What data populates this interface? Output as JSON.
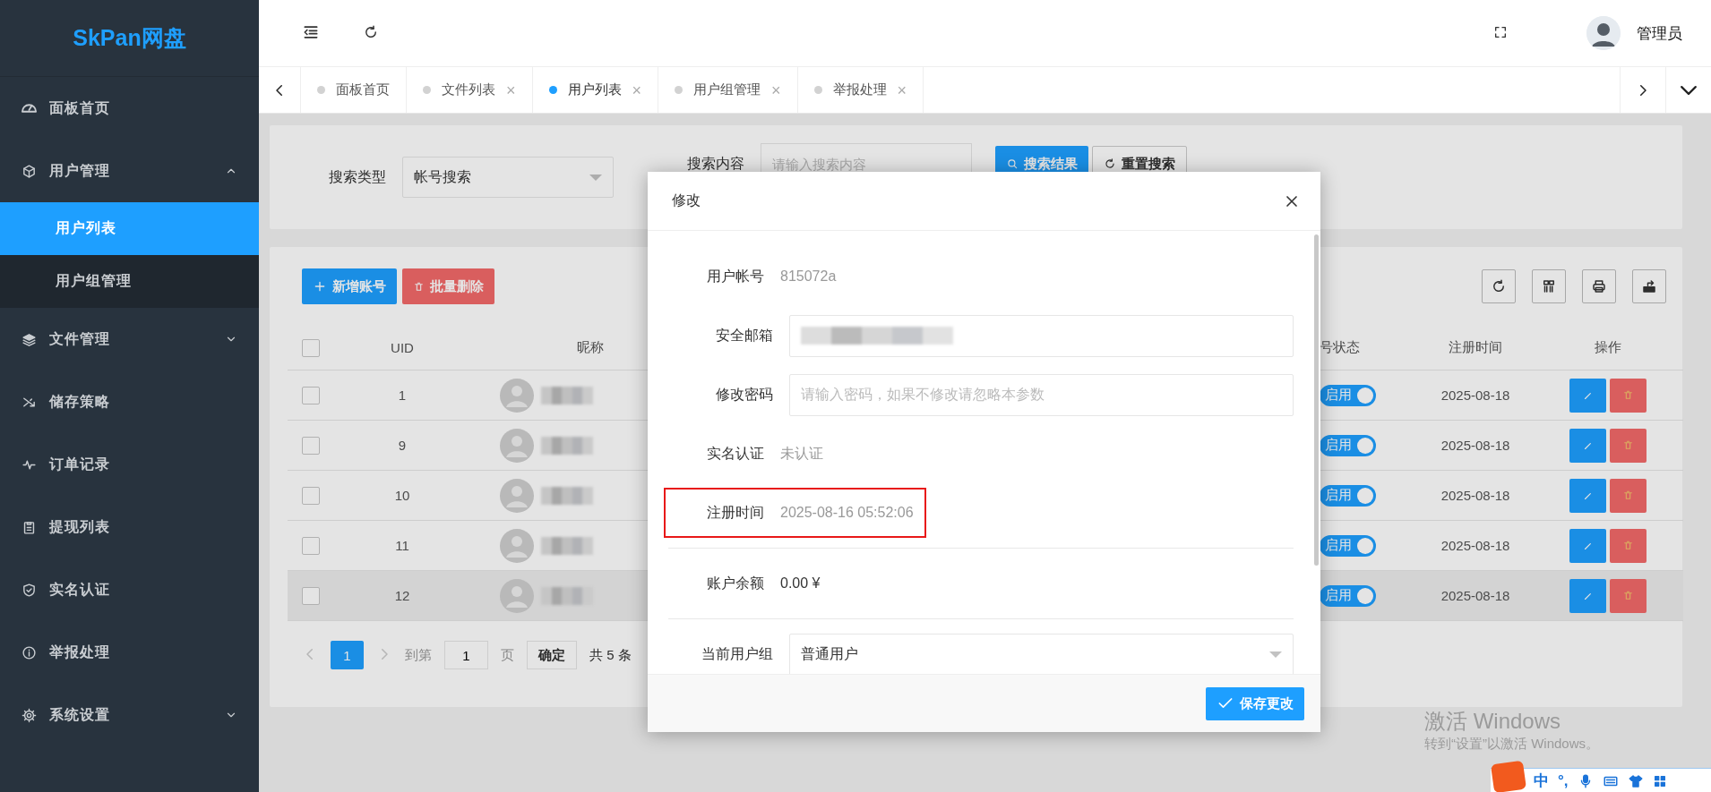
{
  "sidebar": {
    "logo": "SkPan网盘",
    "items": [
      {
        "label": "面板首页",
        "selected": false
      },
      {
        "label": "用户管理",
        "selected": false,
        "expanded": true,
        "children": [
          {
            "label": "用户列表",
            "selected": true
          },
          {
            "label": "用户组管理",
            "selected": false
          }
        ]
      },
      {
        "label": "文件管理",
        "selected": false,
        "expanded": false
      },
      {
        "label": "储存策略",
        "selected": false
      },
      {
        "label": "订单记录",
        "selected": false
      },
      {
        "label": "提现列表",
        "selected": false
      },
      {
        "label": "实名认证",
        "selected": false
      },
      {
        "label": "举报处理",
        "selected": false
      },
      {
        "label": "系统设置",
        "selected": false,
        "expanded": false
      }
    ]
  },
  "header": {
    "user": "管理员"
  },
  "tabs": [
    {
      "label": "面板首页",
      "selected": false
    },
    {
      "label": "文件列表",
      "close": "×",
      "selected": false
    },
    {
      "label": "用户列表",
      "close": "×",
      "selected": true
    },
    {
      "label": "用户组管理",
      "close": "×",
      "selected": false
    },
    {
      "label": "举报处理",
      "close": "×",
      "selected": false
    }
  ],
  "search": {
    "type_label": "搜索类型",
    "type_value": "帐号搜索",
    "content_label": "搜索内容",
    "content_placeholder": "请输入搜索内容",
    "buttons": [
      "搜索结果",
      "重置搜索"
    ]
  },
  "table": {
    "actions": [
      "新增账号",
      "批量删除"
    ],
    "columns": [
      "UID",
      "昵称",
      "号状态",
      "注册时间",
      "操作"
    ],
    "all_checked": false,
    "rows": [
      {
        "uid": "1",
        "checked": false,
        "status": "启用",
        "enabled": true,
        "date": "2025-08-18",
        "highlighted": false
      },
      {
        "uid": "9",
        "checked": false,
        "status": "启用",
        "enabled": true,
        "date": "2025-08-18",
        "highlighted": false
      },
      {
        "uid": "10",
        "checked": false,
        "status": "启用",
        "enabled": true,
        "date": "2025-08-18",
        "highlighted": false
      },
      {
        "uid": "11",
        "checked": false,
        "status": "启用",
        "enabled": true,
        "date": "2025-08-18",
        "highlighted": false
      },
      {
        "uid": "12",
        "checked": false,
        "status": "启用",
        "enabled": true,
        "date": "2025-08-18",
        "highlighted": true
      }
    ]
  },
  "pagination": {
    "pages": [
      {
        "label": "1",
        "selected": true
      }
    ],
    "goto_label": "到第",
    "goto_value": "1",
    "page_unit": "页",
    "confirm": "确定",
    "total": "共 5 条"
  },
  "modal": {
    "title": "修改",
    "groups": [
      [
        {
          "kind": "readonly",
          "label": "用户帐号",
          "value": "815072a",
          "highlighted": false
        },
        {
          "kind": "input",
          "label": "安全邮箱",
          "redacted": true
        },
        {
          "kind": "input",
          "label": "修改密码",
          "placeholder": "请输入密码，如果不修改请忽略本参数"
        },
        {
          "kind": "readonly",
          "label": "实名认证",
          "value": "未认证",
          "highlighted": false
        },
        {
          "kind": "readonly",
          "label": "注册时间",
          "value": "2025-08-16 05:52:06",
          "highlighted": true
        }
      ],
      [
        {
          "kind": "plain",
          "label": "账户余额",
          "value": "0.00 ¥",
          "highlighted": false
        }
      ],
      [
        {
          "kind": "select",
          "label": "当前用户组",
          "value": "普通用户"
        }
      ]
    ],
    "save": "保存更改"
  },
  "os_watermark": {
    "title": "激活 Windows",
    "subtitle": "转到“设置”以激活 Windows。"
  },
  "ime_bar": {
    "mode": "中",
    "punct": "°,"
  }
}
